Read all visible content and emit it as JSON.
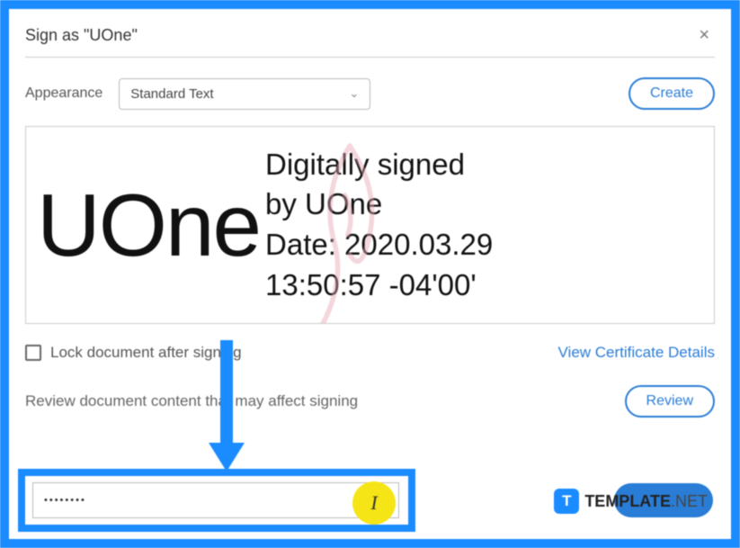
{
  "dialog": {
    "title": "Sign as \"UOne\"",
    "appearance_label": "Appearance",
    "appearance_value": "Standard Text",
    "create_label": "Create",
    "signature_name": "UOne",
    "sig_line1": "Digitally signed",
    "sig_line2": "by UOne",
    "sig_line3": "Date: 2020.03.29",
    "sig_line4": "13:50:57 -04'00'",
    "lock_label": "Lock document after signing",
    "view_cert": "View Certificate Details",
    "review_text": "Review document content that may affect signing",
    "review_label": "Review",
    "password_value": "••••••••"
  },
  "watermark": {
    "icon": "T",
    "bold": "TEMPLATE",
    "rest": ".NET"
  }
}
